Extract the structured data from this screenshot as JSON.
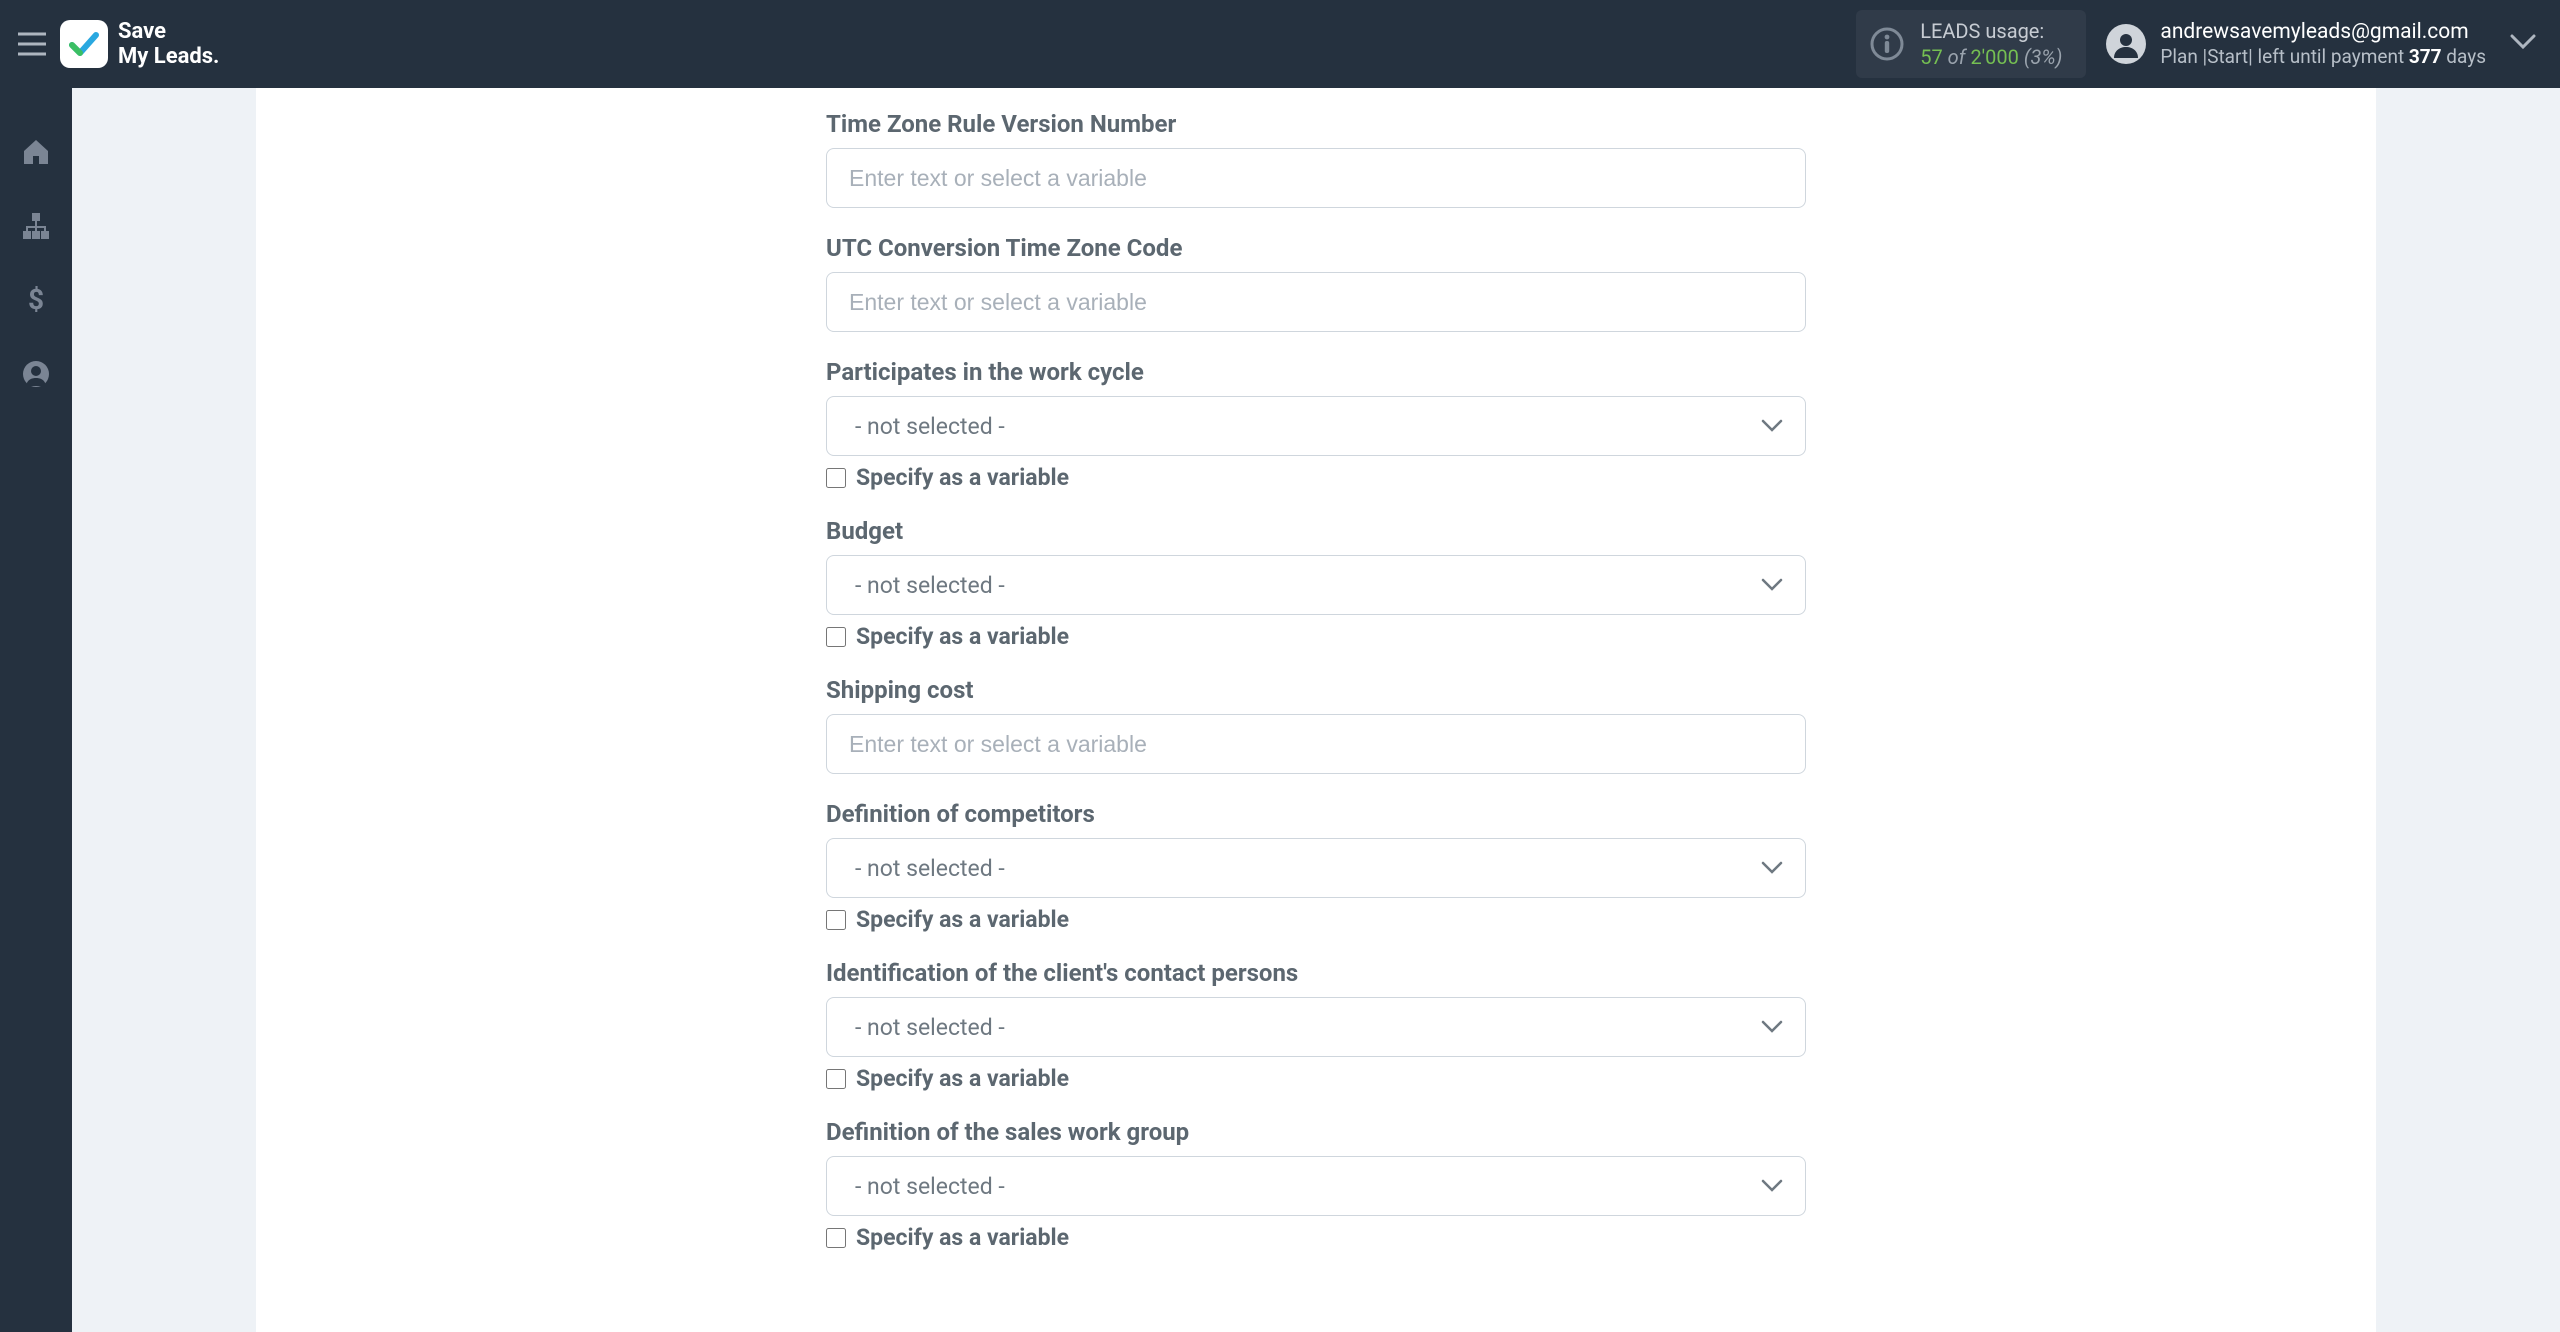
{
  "brand": {
    "line1": "Save",
    "line2": "My Leads."
  },
  "usage": {
    "title": "LEADS usage:",
    "used": "57",
    "of": "of",
    "total": "2'000",
    "pct": "(3%)"
  },
  "account": {
    "email": "andrewsavemyleads@gmail.com",
    "plan_prefix": "Plan |",
    "plan_name": "Start",
    "plan_mid": "| left until payment ",
    "days": "377",
    "plan_suffix": " days"
  },
  "sidebar": {
    "icons": [
      "home-icon",
      "sitemap-icon",
      "dollar-icon",
      "user-icon"
    ]
  },
  "form": {
    "placeholder": "Enter text or select a variable",
    "not_selected": "- not selected -",
    "specify_label": "Specify as a variable",
    "fields": [
      {
        "label": "Time Zone Rule Version Number",
        "type": "text"
      },
      {
        "label": "UTC Conversion Time Zone Code",
        "type": "text"
      },
      {
        "label": "Participates in the work cycle",
        "type": "select",
        "specify": true
      },
      {
        "label": "Budget",
        "type": "select",
        "specify": true
      },
      {
        "label": "Shipping cost",
        "type": "text"
      },
      {
        "label": "Definition of competitors",
        "type": "select",
        "specify": true
      },
      {
        "label": "Identification of the client's contact persons",
        "type": "select",
        "specify": true
      },
      {
        "label": "Definition of the sales work group",
        "type": "select",
        "specify": true
      }
    ]
  }
}
